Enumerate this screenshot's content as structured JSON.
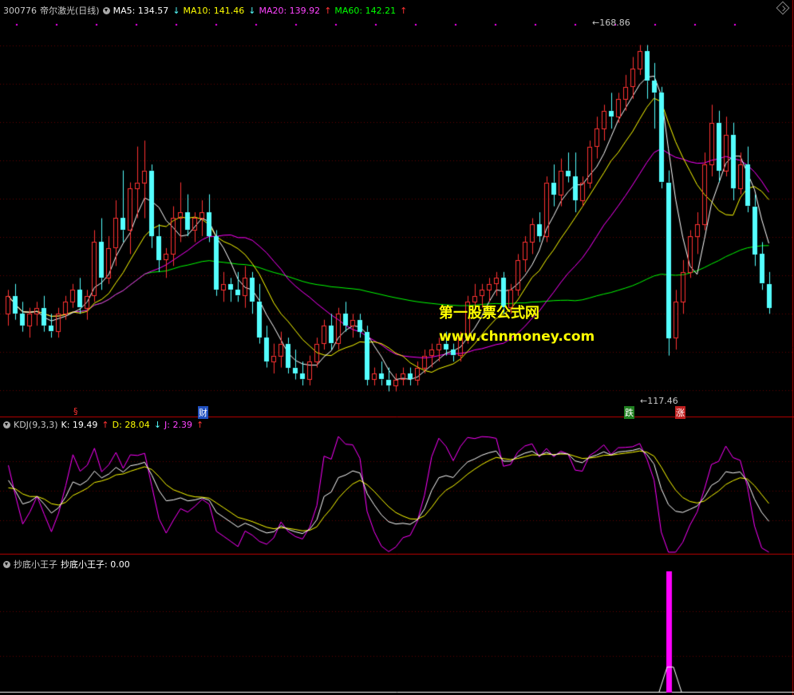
{
  "stock": {
    "code": "300776",
    "name": "帝尔激光(日线)",
    "ma5_label": "MA5: 134.57",
    "ma5_arrow": "↓",
    "ma10_label": "MA10: 141.46",
    "ma10_arrow": "↓",
    "ma20_label": "MA20: 139.92",
    "ma20_arrow": "↑",
    "ma60_label": "MA60: 142.21",
    "ma60_arrow": "↑"
  },
  "price_labels": {
    "high": "168.86",
    "low": "117.46"
  },
  "markers": {
    "m1": "§",
    "m2": "财",
    "m3": "跌",
    "m4": "涨"
  },
  "watermark": {
    "line1": "第一股票公式网",
    "line2": "www.chnmoney.com"
  },
  "kdj": {
    "title": "KDJ(9,3,3)",
    "k_label": "K: 19.49",
    "k_arrow": "↑",
    "d_label": "D: 28.04",
    "d_arrow": "↓",
    "j_label": "J: 2.39",
    "j_arrow": "↑"
  },
  "indicator": {
    "title": "抄底小王子",
    "value_label": "抄底小王子: 0.00"
  },
  "colors": {
    "up": "#ff3232",
    "down": "#54ffff",
    "ma5": "#ffffff",
    "ma10": "#ffff00",
    "ma20": "#ff00ff",
    "ma60": "#00ff00",
    "grid": "#600000",
    "separator": "#c00000",
    "indicator_bar": "#ff00ff"
  },
  "chart_data": {
    "type": "candlestick",
    "price_range": [
      110,
      172
    ],
    "candles": [
      [
        124,
        128,
        122,
        127
      ],
      [
        127,
        129,
        123,
        124
      ],
      [
        124,
        126,
        121,
        122
      ],
      [
        122,
        125,
        120,
        124
      ],
      [
        124,
        126,
        122,
        125
      ],
      [
        125,
        127,
        121,
        122
      ],
      [
        122,
        124,
        120,
        121
      ],
      [
        121,
        125,
        120,
        124
      ],
      [
        124,
        127,
        123,
        126
      ],
      [
        126,
        129,
        125,
        128
      ],
      [
        128,
        130,
        124,
        125
      ],
      [
        125,
        128,
        123,
        127
      ],
      [
        127,
        138,
        126,
        136
      ],
      [
        136,
        140,
        128,
        130
      ],
      [
        130,
        137,
        129,
        135
      ],
      [
        135,
        143,
        132,
        140
      ],
      [
        140,
        148,
        136,
        138
      ],
      [
        138,
        146,
        134,
        145
      ],
      [
        145,
        152,
        140,
        146
      ],
      [
        146,
        153,
        140,
        148
      ],
      [
        148,
        149,
        135,
        137
      ],
      [
        137,
        139,
        131,
        133
      ],
      [
        133,
        135,
        130,
        134
      ],
      [
        134,
        142,
        132,
        140
      ],
      [
        140,
        146,
        136,
        141
      ],
      [
        141,
        144,
        137,
        138
      ],
      [
        138,
        141,
        136,
        140
      ],
      [
        140,
        143,
        137,
        141
      ],
      [
        141,
        144,
        136,
        137
      ],
      [
        137,
        138,
        127,
        128
      ],
      [
        128,
        131,
        126,
        129
      ],
      [
        129,
        130,
        126,
        128
      ],
      [
        128,
        131,
        126,
        127
      ],
      [
        127,
        132,
        125,
        130
      ],
      [
        130,
        131,
        124,
        126
      ],
      [
        126,
        129,
        119,
        120
      ],
      [
        120,
        122,
        115,
        116
      ],
      [
        116,
        119,
        114,
        117
      ],
      [
        117,
        121,
        115,
        119
      ],
      [
        119,
        120,
        114,
        115
      ],
      [
        115,
        118,
        113,
        114
      ],
      [
        114,
        116,
        112,
        113
      ],
      [
        113,
        117,
        112,
        116
      ],
      [
        116,
        120,
        115,
        119
      ],
      [
        119,
        123,
        118,
        122
      ],
      [
        122,
        124,
        118,
        119
      ],
      [
        119,
        125,
        118,
        124
      ],
      [
        124,
        126,
        121,
        122
      ],
      [
        122,
        124,
        120,
        123
      ],
      [
        123,
        124,
        120,
        121
      ],
      [
        121,
        122,
        112,
        113
      ],
      [
        113,
        115,
        112,
        114
      ],
      [
        114,
        116,
        112,
        113
      ],
      [
        113,
        115,
        111,
        112
      ],
      [
        112,
        114,
        111,
        113
      ],
      [
        113,
        115,
        112,
        114
      ],
      [
        114,
        115,
        112,
        113
      ],
      [
        113,
        116,
        112,
        115
      ],
      [
        115,
        118,
        114,
        117
      ],
      [
        117,
        119,
        115,
        118
      ],
      [
        118,
        120,
        116,
        119
      ],
      [
        119,
        121,
        117,
        118
      ],
      [
        118,
        119,
        116,
        117
      ],
      [
        117,
        121,
        116,
        120
      ],
      [
        120,
        127,
        119,
        126
      ],
      [
        126,
        129,
        125,
        127
      ],
      [
        127,
        129,
        125,
        128
      ],
      [
        128,
        130,
        126,
        129
      ],
      [
        129,
        131,
        127,
        130
      ],
      [
        130,
        131,
        124,
        125
      ],
      [
        125,
        129,
        124,
        128
      ],
      [
        128,
        134,
        127,
        133
      ],
      [
        133,
        137,
        131,
        136
      ],
      [
        136,
        140,
        134,
        139
      ],
      [
        139,
        141,
        136,
        137
      ],
      [
        137,
        147,
        136,
        146
      ],
      [
        146,
        149,
        142,
        144
      ],
      [
        144,
        150,
        142,
        148
      ],
      [
        148,
        151,
        146,
        147
      ],
      [
        147,
        151,
        141,
        143
      ],
      [
        143,
        147,
        142,
        146
      ],
      [
        146,
        153,
        145,
        152
      ],
      [
        152,
        157,
        150,
        155
      ],
      [
        155,
        159,
        153,
        158
      ],
      [
        158,
        161,
        155,
        157
      ],
      [
        157,
        161,
        156,
        160
      ],
      [
        160,
        164,
        158,
        162
      ],
      [
        162,
        167,
        160,
        165
      ],
      [
        165,
        169,
        164,
        168
      ],
      [
        168,
        169,
        160,
        163
      ],
      [
        163,
        166,
        155,
        161
      ],
      [
        161,
        162,
        145,
        146
      ],
      [
        146,
        148,
        117,
        120
      ],
      [
        120,
        128,
        118,
        126
      ],
      [
        126,
        133,
        124,
        131
      ],
      [
        131,
        138,
        130,
        137
      ],
      [
        137,
        141,
        134,
        139
      ],
      [
        139,
        151,
        138,
        149
      ],
      [
        149,
        159,
        147,
        156
      ],
      [
        156,
        158,
        146,
        148
      ],
      [
        148,
        157,
        147,
        154
      ],
      [
        154,
        156,
        143,
        145
      ],
      [
        145,
        151,
        144,
        149
      ],
      [
        149,
        152,
        141,
        142
      ],
      [
        142,
        144,
        132,
        134
      ],
      [
        134,
        136,
        128,
        129
      ],
      [
        129,
        131,
        124,
        125
      ]
    ]
  }
}
